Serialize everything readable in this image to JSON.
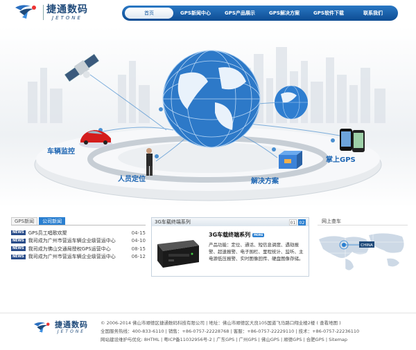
{
  "logo": {
    "name_cn": "捷通数码",
    "name_en": "JETONE"
  },
  "nav": [
    {
      "label": "首页",
      "active": true
    },
    {
      "label": "GPS新闻中心"
    },
    {
      "label": "GPS产品展示"
    },
    {
      "label": "GPS解决方案"
    },
    {
      "label": "GPS软件下载"
    },
    {
      "label": "联系我们"
    }
  ],
  "banner": {
    "labels": {
      "vehicle": "车辆监控",
      "person": "人员定位",
      "solution": "解决方案",
      "handheld": "掌上GPS"
    }
  },
  "news": {
    "tabs": [
      {
        "label": "GPS新闻"
      },
      {
        "label": "公司新闻",
        "active": true
      }
    ],
    "badge": "NEWS",
    "items": [
      {
        "title": "GPS员工唱歌欢聚",
        "date": "04-15"
      },
      {
        "title": "我司成为广州市营运车辆企业级营运中心",
        "date": "04-10"
      },
      {
        "title": "我司成为佛山交通局授权GPS运营中心",
        "date": "08-15"
      },
      {
        "title": "我司成为广州市营运车辆企业级营运中心",
        "date": "06-12"
      }
    ]
  },
  "product": {
    "header": "3G车载终端系列",
    "pages": [
      "01",
      "02"
    ],
    "active_page": "02",
    "name": "3G车载终端系列",
    "more": "MORE",
    "desc": "产品功能：定位、通话、短信息调度、遇劫报警、超速报警、电子围栏、里程统计、监听、主电源低压报警、实时图像回传、硬盘图像存储。"
  },
  "map": {
    "title": "网上查车",
    "china": "CHINA"
  },
  "footer": {
    "logo_cn": "捷通数码",
    "logo_en": "JETONE",
    "line1": "© 2006-2014 佛山市顺德区捷通数码科技有限公司 | 地址：佛山市顺德区大良105国道飞马路口翔业楼2楼 ( 查看地图 )",
    "line2": "全国服务热线：400-833-6110 | 销售：+86-0757-22228768 | 客服：+86-0757-22229110 | 技术：+86-0757-22236110",
    "line3": "网站建设维护与优化: 8HTML | 粤ICP备11032956号-2 | 广东GPS | 广州GPS | 佛山GPS | 顺德GPS | 合肥GPS | Sitemap"
  },
  "colors": {
    "brand": "#1c5ea4",
    "nav_bg": "#0d4c93",
    "accent": "#2a7fd0"
  }
}
